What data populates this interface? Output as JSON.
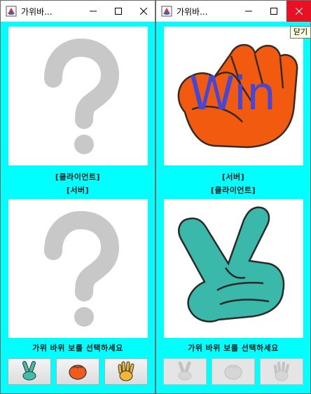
{
  "colors": {
    "window_bg": "#00ffff",
    "panel_bg": "#ffffff",
    "close_hover": "#e81123",
    "win_text": "#4747d6"
  },
  "left_window": {
    "title": "가위바...",
    "top_panel_image": "question-mark",
    "bottom_panel_image": "question-mark",
    "label_top": "[클라이언트]",
    "label_mid": "[서버]",
    "prompt": "가위 바위 보를 선택하세요",
    "choices": [
      {
        "icon": "scissors-hand-icon",
        "enabled": true
      },
      {
        "icon": "rock-fist-icon",
        "enabled": true
      },
      {
        "icon": "paper-hand-icon",
        "enabled": true
      }
    ]
  },
  "right_window": {
    "title": "가위바...",
    "top_panel_image": "rock-fist",
    "top_panel_overlay": "Win",
    "bottom_panel_image": "scissors-hand",
    "label_top": "[서버]",
    "label_mid": "[클라이언트]",
    "prompt": "가위 바위 보를 선택하세요",
    "choices": [
      {
        "icon": "scissors-hand-icon",
        "enabled": false
      },
      {
        "icon": "rock-fist-icon",
        "enabled": false
      },
      {
        "icon": "paper-hand-icon",
        "enabled": false
      }
    ]
  },
  "tooltip": {
    "text": "닫기"
  }
}
